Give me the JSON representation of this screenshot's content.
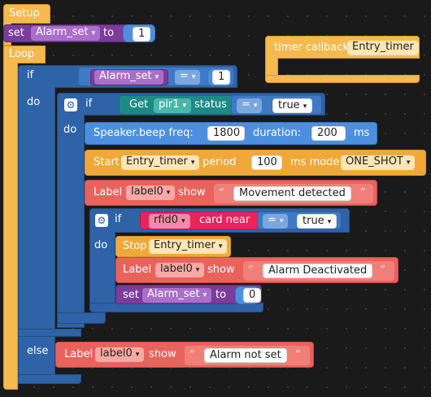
{
  "setup_block": {
    "label": "Setup",
    "set_keyword": "set",
    "variable": "Alarm_set",
    "to_keyword": "to",
    "value": "1"
  },
  "loop_block": {
    "label": "Loop",
    "if_keyword": "if",
    "do_keyword": "do",
    "else_keyword": "else",
    "condition": {
      "variable": "Alarm_set",
      "operator": "=",
      "value": "1"
    }
  },
  "inner_if": {
    "if_keyword": "if",
    "do_keyword": "do",
    "get_label": "Get",
    "sensor": "pir1",
    "status_label": "status",
    "operator": "=",
    "value": "true"
  },
  "beep_block": {
    "label": "Speaker.beep freq:",
    "freq": "1800",
    "duration_label": "duration:",
    "duration": "200",
    "unit": "ms"
  },
  "start_timer_block": {
    "label": "Start",
    "timer": "Entry_timer",
    "period_label": "period",
    "period": "100",
    "mode_label": "ms mode",
    "mode": "ONE_SHOT"
  },
  "label_block_1": {
    "label": "Label",
    "target": "label0",
    "show_label": "show",
    "text": "Movement detected"
  },
  "rfid_if": {
    "if_keyword": "if",
    "do_keyword": "do",
    "reader": "rfid0",
    "card_near_label": "card near",
    "operator": "=",
    "value": "true"
  },
  "stop_timer_block": {
    "label": "Stop",
    "timer": "Entry_timer"
  },
  "label_block_2": {
    "label": "Label",
    "target": "label0",
    "show_label": "show",
    "text": "Alarm Deactivated"
  },
  "set_block_2": {
    "set_keyword": "set",
    "variable": "Alarm_set",
    "to_keyword": "to",
    "value": "0"
  },
  "label_block_else": {
    "label": "Label",
    "target": "label0",
    "show_label": "show",
    "text": "Alarm not set"
  },
  "timer_callback": {
    "label": "timer callback",
    "timer": "Entry_timer"
  },
  "quote_open": "“",
  "quote_close": "”",
  "dropdown_arrow": "▾",
  "gear_glyph": "⚙"
}
